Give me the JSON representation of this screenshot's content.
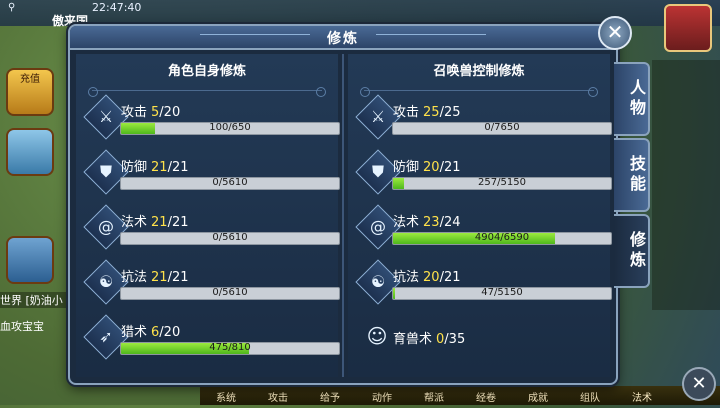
{
  "background": {
    "time": "22:47:40",
    "top_name": "傲来国",
    "recharge": "充值",
    "chat_channel": "世界",
    "chat_text": "[奶油小",
    "chat_line2": "血攻宝宝",
    "bottom_menu": [
      "系统",
      "攻击",
      "给予",
      "动作",
      "帮派",
      "经卷",
      "成就",
      "组队",
      "法术"
    ]
  },
  "panel": {
    "title": "修炼",
    "close_icon": "close-icon"
  },
  "left_column": {
    "title": "角色自身修炼",
    "rows": [
      {
        "name": "攻击",
        "current": "5",
        "max": "/20",
        "progress": "100/650",
        "fill": 0.154,
        "icon": "sword-icon",
        "glyph": "⚔"
      },
      {
        "name": "防御",
        "current": "21",
        "max": "/21",
        "progress": "0/5610",
        "fill": 0.0,
        "icon": "shield-icon",
        "glyph": "⛊"
      },
      {
        "name": "法术",
        "current": "21",
        "max": "/21",
        "progress": "0/5610",
        "fill": 0.0,
        "icon": "spiral-icon",
        "glyph": "@"
      },
      {
        "name": "抗法",
        "current": "21",
        "max": "/21",
        "progress": "0/5610",
        "fill": 0.0,
        "icon": "yin-yang-icon",
        "glyph": "☯"
      },
      {
        "name": "猎术",
        "current": "6",
        "max": "/20",
        "progress": "475/810",
        "fill": 0.586,
        "icon": "bow-icon",
        "glyph": "➶"
      }
    ]
  },
  "right_column": {
    "title": "召唤兽控制修炼",
    "rows": [
      {
        "name": "攻击",
        "current": "25",
        "max": "/25",
        "progress": "0/7650",
        "fill": 0.0,
        "icon": "sword-icon",
        "glyph": "⚔"
      },
      {
        "name": "防御",
        "current": "20",
        "max": "/21",
        "progress": "257/5150",
        "fill": 0.05,
        "icon": "shield-icon",
        "glyph": "⛊"
      },
      {
        "name": "法术",
        "current": "23",
        "max": "/24",
        "progress": "4904/6590",
        "fill": 0.744,
        "icon": "spiral-icon",
        "glyph": "@"
      },
      {
        "name": "抗法",
        "current": "20",
        "max": "/21",
        "progress": "47/5150",
        "fill": 0.009,
        "icon": "yin-yang-icon",
        "glyph": "☯"
      }
    ],
    "special_row": {
      "name": "育兽术",
      "current": "0",
      "max": "/35",
      "icon": "beast-icon",
      "glyph": "☺"
    }
  },
  "tabs": [
    {
      "label": "人物",
      "active": false
    },
    {
      "label": "技能",
      "active": false
    },
    {
      "label": "修炼",
      "active": true
    }
  ]
}
